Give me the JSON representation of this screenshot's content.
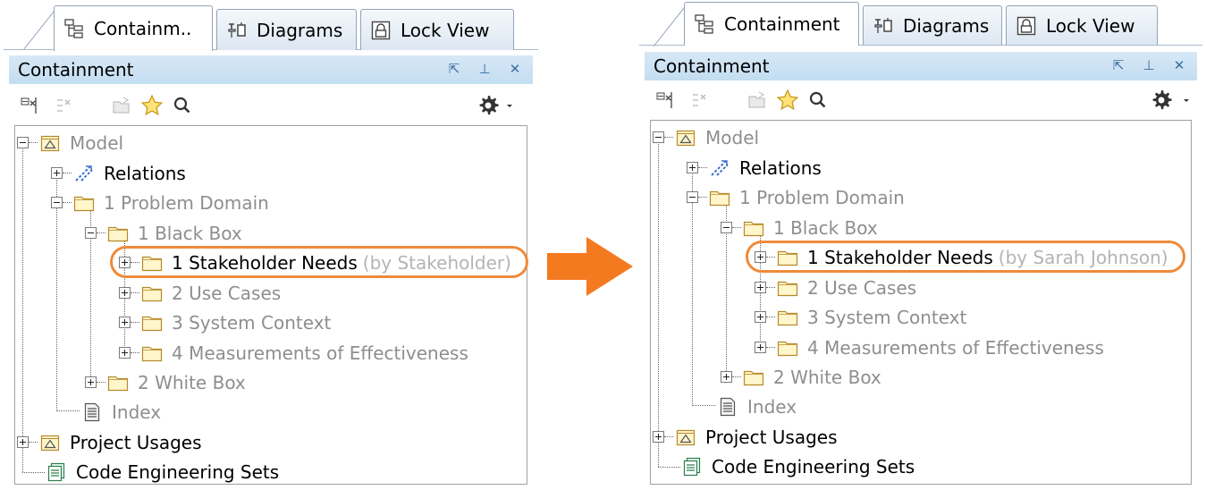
{
  "colors": {
    "highlight": "#ef8a3a",
    "arrow": "#f47a20",
    "titlebar": "#c9e0f3",
    "folder": "#fff6cc"
  },
  "left": {
    "tabs": [
      {
        "label": "Containm..",
        "icon": "containment-tree-icon"
      },
      {
        "label": "Diagrams",
        "icon": "diagrams-icon"
      },
      {
        "label": "Lock View",
        "icon": "lock-view-icon"
      }
    ],
    "title": "Containment",
    "tree": {
      "model": "Model",
      "relations": "Relations",
      "problem_domain": "1 Problem Domain",
      "black_box": "1 Black Box",
      "stakeholder_needs": "1 Stakeholder Needs",
      "stakeholder_suffix": "(by Stakeholder)",
      "use_cases": "2 Use Cases",
      "system_context": "3 System Context",
      "moe": "4 Measurements of Effectiveness",
      "white_box": "2 White Box",
      "index": "Index",
      "project_usages": "Project Usages",
      "code_sets": "Code Engineering Sets"
    }
  },
  "right": {
    "tabs": [
      {
        "label": "Containment",
        "icon": "containment-tree-icon"
      },
      {
        "label": "Diagrams",
        "icon": "diagrams-icon"
      },
      {
        "label": "Lock View",
        "icon": "lock-view-icon"
      }
    ],
    "title": "Containment",
    "tree": {
      "model": "Model",
      "relations": "Relations",
      "problem_domain": "1 Problem Domain",
      "black_box": "1 Black Box",
      "stakeholder_needs": "1 Stakeholder Needs",
      "stakeholder_suffix": "(by Sarah Johnson)",
      "use_cases": "2 Use Cases",
      "system_context": "3 System Context",
      "moe": "4 Measurements of Effectiveness",
      "white_box": "2 White Box",
      "index": "Index",
      "project_usages": "Project Usages",
      "code_sets": "Code Engineering Sets"
    }
  },
  "window_buttons": {
    "restore": "⇱",
    "pin": "⊥",
    "close": "✕"
  }
}
